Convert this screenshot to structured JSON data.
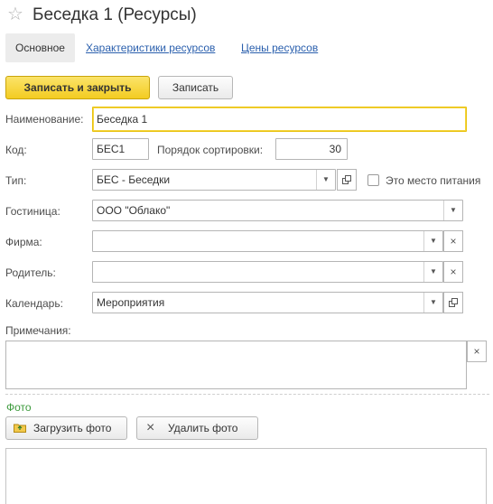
{
  "window": {
    "star_icon": "star-icon",
    "title": "Беседка 1 (Ресурсы)"
  },
  "tabs": [
    {
      "label": "Основное",
      "active": true
    },
    {
      "label": "Характеристики ресурсов",
      "active": false
    },
    {
      "label": "Цены ресурсов",
      "active": false
    }
  ],
  "toolbar": {
    "save_close_label": "Записать и закрыть",
    "save_label": "Записать"
  },
  "form": {
    "name": {
      "label": "Наименование:",
      "value": "Беседка 1"
    },
    "code": {
      "label": "Код:",
      "value": "БЕС1"
    },
    "sort": {
      "label": "Порядок сортировки:",
      "value": "30"
    },
    "type": {
      "label": "Тип:",
      "value": "БЕС - Беседки"
    },
    "food_place": {
      "label": "Это место питания",
      "checked": false
    },
    "hotel": {
      "label": "Гостиница:",
      "value": "ООО \"Облако\""
    },
    "firm": {
      "label": "Фирма:",
      "value": ""
    },
    "parent": {
      "label": "Родитель:",
      "value": ""
    },
    "calendar": {
      "label": "Календарь:",
      "value": "Мероприятия"
    },
    "notes": {
      "label": "Примечания:",
      "value": ""
    }
  },
  "photo": {
    "group_title": "Фото",
    "upload_label": "Загрузить фото",
    "delete_label": "Удалить фото"
  },
  "colors": {
    "accent_yellow": "#f3cc21",
    "link_blue": "#2a5fad",
    "group_green": "#3c9a3c"
  }
}
